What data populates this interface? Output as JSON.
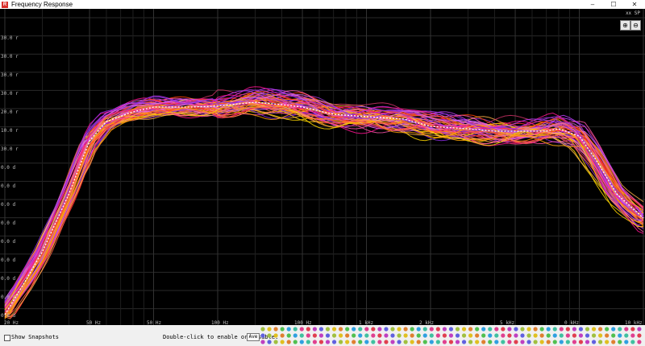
{
  "window": {
    "title": "Frequency Response",
    "app_icon": "rew-app-icon",
    "controls": [
      "–",
      "☐",
      "✕"
    ]
  },
  "plot": {
    "background": "#000000",
    "scale_label": "xx SP",
    "y_tick_labels": [
      "30.0 r",
      "30.0 r",
      "30.0 r",
      "30.0 r",
      "20.0 r",
      "10.0 r",
      "30.0 r",
      "0.0 d",
      "0.0 d",
      "0.0 d",
      "0.0 d",
      "0.0 d",
      "0.0 d",
      "0.0 d",
      "0.0 d",
      "0.0 d"
    ],
    "x_tick_labels": [
      "20 Hz",
      "50 Hz",
      "50 Hz",
      "100 Hz",
      "100 Hz",
      "1 kHz",
      "2 kHz",
      "5 kHz",
      "0 kHz",
      "10 kHz"
    ],
    "zoom_in_icon": "zoom-in-icon",
    "zoom_out_icon": "zoom-out-icon"
  },
  "chart_data": {
    "type": "line",
    "xscale": "log",
    "xlim": [
      20,
      20000
    ],
    "grid": true,
    "legend": "none",
    "trace_count": 60,
    "trace_colors": [
      "#ff8c00",
      "#ff3030",
      "#ff55aa",
      "#c040ff",
      "#ffd700",
      "#ff7f50",
      "#9932cc",
      "#ff1493",
      "#ff6347",
      "#da70d6",
      "#ffa500",
      "#8a2be2",
      "#ff4500",
      "#e066ff",
      "#ffb347",
      "#cc3366"
    ],
    "average_trace": {
      "color": "#ffffff",
      "style": "dotted"
    },
    "response_shape": {
      "x": [
        20,
        25,
        30,
        40,
        50,
        60,
        80,
        100,
        150,
        200,
        300,
        400,
        500,
        700,
        1000,
        1500,
        2000,
        3000,
        4000,
        5000,
        7000,
        8000,
        10000,
        12000,
        15000,
        20000
      ],
      "y_rel": [
        -40,
        -33,
        -27,
        -15,
        -4,
        0,
        2,
        3,
        3,
        3.2,
        4,
        3.5,
        3,
        1.5,
        1,
        0.5,
        -1,
        -1.5,
        -2,
        -2,
        -2,
        -1.5,
        -3,
        -8,
        -15,
        -20
      ]
    }
  },
  "bottom_bar": {
    "show_snapshots_label": "Show Snapshots",
    "hint_label": "Double-click to enable or disable:",
    "ave_label": "Ave",
    "dot_colors": [
      "#a0c040",
      "#e04050",
      "#30a0e0",
      "#e0c020",
      "#c040c0",
      "#40c0a0",
      "#e08030",
      "#6060e0",
      "#e04090",
      "#50c050"
    ]
  }
}
